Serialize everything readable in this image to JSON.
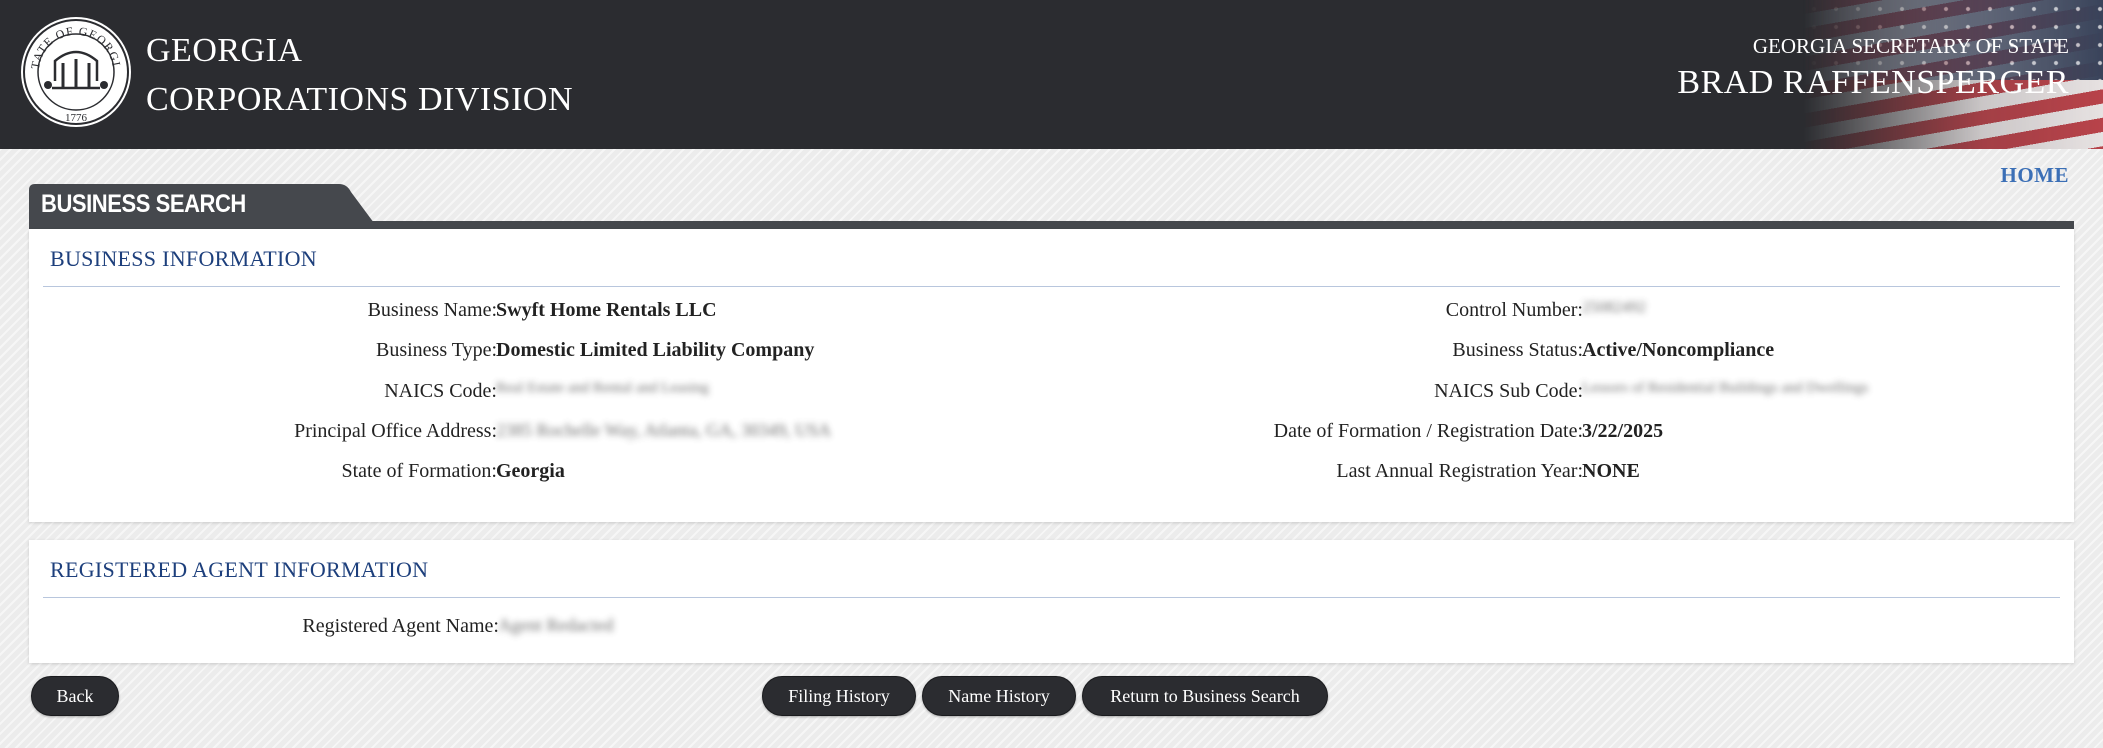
{
  "header": {
    "seal": {
      "icon": "georgia-state-seal",
      "text_top": "STATE OF GEORGIA",
      "year": "1776"
    },
    "org_line1": "GEORGIA",
    "org_line2": "CORPORATIONS DIVISION",
    "office": "GEORGIA SECRETARY OF STATE",
    "official_name": "BRAD RAFFENSPERGER"
  },
  "nav": {
    "home": "HOME"
  },
  "page_title": "BUSINESS SEARCH",
  "business_info": {
    "heading": "BUSINESS INFORMATION",
    "left": [
      {
        "label": "Business Name:",
        "value": "Swyft Home Rentals LLC",
        "blurred": false
      },
      {
        "label": "Business Type:",
        "value": "Domestic Limited Liability Company",
        "blurred": false
      },
      {
        "label": "NAICS Code:",
        "value": "Real Estate and Rental and Leasing",
        "blurred": true
      },
      {
        "label": "Principal Office Address:",
        "value": "2385 Rochelle Way, Atlanta, GA, 30349, USA",
        "blurred": true
      },
      {
        "label": "State of Formation:",
        "value": "Georgia",
        "blurred": false
      }
    ],
    "right": [
      {
        "label": "Control Number:",
        "value": "25082492",
        "blurred": true
      },
      {
        "label": "Business Status:",
        "value": "Active/Noncompliance",
        "blurred": false
      },
      {
        "label": "NAICS Sub Code:",
        "value": "Lessors of Residential Buildings and Dwellings",
        "blurred": true
      },
      {
        "label": "Date of Formation / Registration Date:",
        "value": "3/22/2025",
        "blurred": false
      },
      {
        "label": "Last Annual Registration Year:",
        "value": "NONE",
        "blurred": false
      }
    ]
  },
  "agent_info": {
    "heading": "REGISTERED AGENT INFORMATION",
    "label": "Registered Agent Name:",
    "value": "Agent Redacted",
    "blurred": true
  },
  "buttons": {
    "back": "Back",
    "filing_history": "Filing History",
    "name_history": "Name History",
    "return_search": "Return to Business Search"
  },
  "colors": {
    "header_bg": "#2b2c30",
    "heading_blue": "#1d3f7c",
    "link_blue": "#3b6fb6",
    "button_bg": "#2b2c30"
  }
}
